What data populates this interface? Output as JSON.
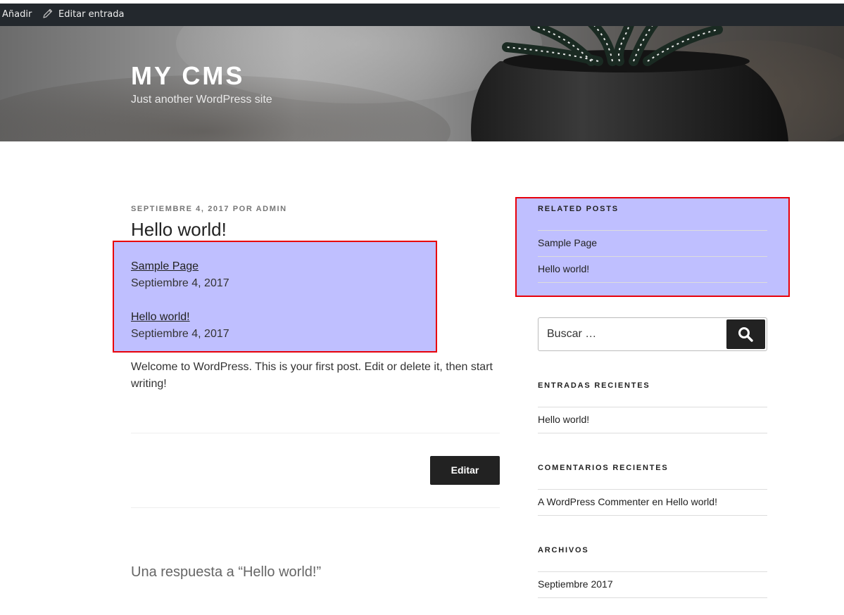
{
  "admin_bar": {
    "add_label": "Añadir",
    "edit_label": "Editar entrada"
  },
  "header": {
    "site_title": "MY CMS",
    "tagline": "Just another WordPress site"
  },
  "post": {
    "meta_date": "SEPTIEMBRE 4, 2017",
    "meta_by": "POR",
    "meta_author": "ADMIN",
    "title": "Hello world!",
    "related": [
      {
        "title": "Sample Page",
        "date": "Septiembre 4, 2017"
      },
      {
        "title": "Hello world!",
        "date": "Septiembre 4, 2017"
      }
    ],
    "body": "Welcome to WordPress. This is your first post. Edit or delete it, then start writing!",
    "edit_button": "Editar",
    "comments_title": "Una respuesta a “Hello world!”"
  },
  "sidebar": {
    "related_posts": {
      "title": "RELATED POSTS",
      "items": [
        "Sample Page",
        "Hello world!"
      ]
    },
    "search": {
      "placeholder": "Buscar …"
    },
    "recent_posts": {
      "title": "ENTRADAS RECIENTES",
      "items": [
        "Hello world!"
      ]
    },
    "recent_comments": {
      "title": "COMENTARIOS RECIENTES",
      "author": "A WordPress Commenter",
      "on": "en",
      "post": "Hello world!"
    },
    "archives": {
      "title": "ARCHIVOS",
      "items": [
        "Septiembre 2017"
      ]
    }
  },
  "colors": {
    "highlight_fill": "#bfbfff",
    "highlight_border": "#e8000a",
    "admin_bar_bg": "#23282d",
    "button_bg": "#222222"
  },
  "icons": [
    "pencil-icon",
    "search-icon"
  ]
}
